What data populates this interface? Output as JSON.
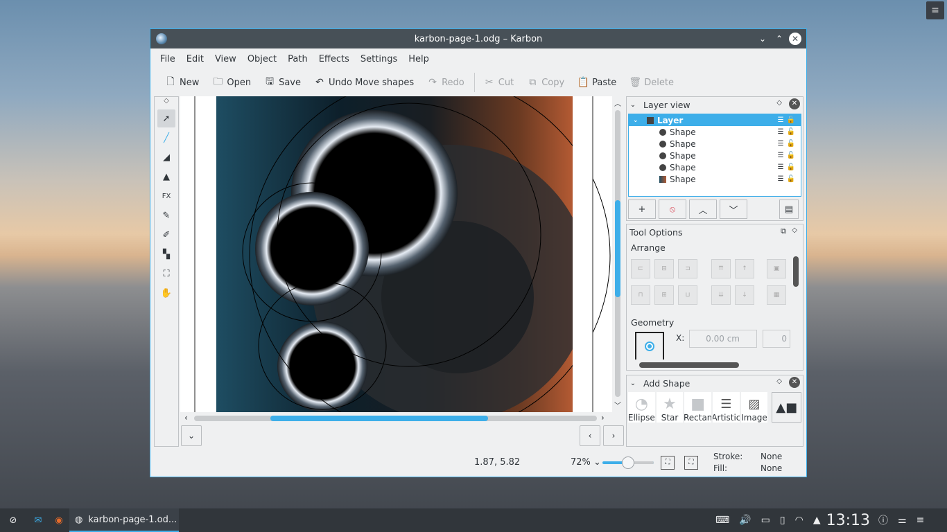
{
  "window": {
    "title": "karbon-page-1.odg – Karbon"
  },
  "menu": [
    "File",
    "Edit",
    "View",
    "Object",
    "Path",
    "Effects",
    "Settings",
    "Help"
  ],
  "toolbar": {
    "new": "New",
    "open": "Open",
    "save": "Save",
    "undo": "Undo Move shapes",
    "redo": "Redo",
    "cut": "Cut",
    "copy": "Copy",
    "paste": "Paste",
    "delete": "Delete"
  },
  "status": {
    "coords": "1.87, 5.82",
    "zoom": "72%",
    "stroke_label": "Stroke:",
    "stroke_value": "None",
    "fill_label": "Fill:",
    "fill_value": "None"
  },
  "layer_view": {
    "title": "Layer view",
    "layer_name": "Layer",
    "shapes": [
      "Shape",
      "Shape",
      "Shape",
      "Shape",
      "Shape"
    ]
  },
  "tool_options": {
    "title": "Tool Options",
    "arrange": "Arrange",
    "geometry": "Geometry",
    "x_label": "X:",
    "x_value": "0.00 cm",
    "y_value_partial": "0"
  },
  "add_shape": {
    "title": "Add Shape",
    "items": [
      "Ellipse",
      "Star",
      "Rectan",
      "Artistic",
      "Image"
    ]
  },
  "taskbar": {
    "task_label": "karbon-page-1.od...",
    "clock": "13:13"
  },
  "colors": {
    "accent": "#3daee9",
    "titlebar": "#475057",
    "taskbar": "#31363b"
  }
}
